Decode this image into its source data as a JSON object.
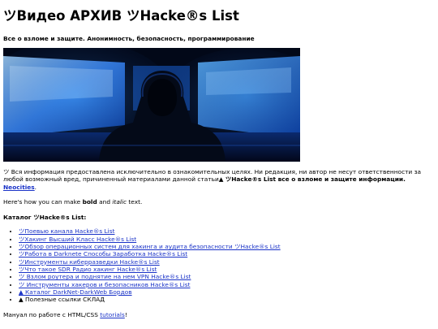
{
  "header": {
    "title": "ツВидео АРХИВ ツHacke®s List",
    "subtitle": "Все о взломе и защите. Анонимность, безопасность, программирование"
  },
  "hero": {
    "icon": "hacker-hoodie-monitors-image"
  },
  "info": {
    "text": "ツ Вся информация предоставлена исключительно в ознакомительных целях. Ни редакция, ни автор не несут ответственности за любой возможный вред, причиненный материалами данной статьи▲ ",
    "bold": "ツHacke®s List все о взломе и защите информации.",
    "link": "Neocities",
    "end": "."
  },
  "howto": {
    "prefix": "Here's how you can make ",
    "bold": "bold",
    "middle": " and ",
    "italic": "italic",
    "suffix": " text."
  },
  "catalog": {
    "title": "Каталог ツHacke®s List:",
    "items": [
      {
        "label": "ツПоевью канала Hacke®s List",
        "link": true
      },
      {
        "label": "ツХакинг Высший Класс Hacke®s List",
        "link": true
      },
      {
        "label": "ツОбзор операционных систем для хакинга и аудита безопасности ツHacke®s List",
        "link": true
      },
      {
        "label": "ツРабота в Darknete Способы Заработка Hacke®s List",
        "link": true
      },
      {
        "label": "ツИнструменты киберразведки Hacke®s List",
        "link": true
      },
      {
        "label": "ツЧто такое SDR Радио хакинг Hacke®s List",
        "link": true
      },
      {
        "label": "ツ Взлом роутера и поднятие на нем VPN Hacke®s List",
        "link": true
      },
      {
        "label": "ツ Инструменты хакеров и безопасников Hacke®s List",
        "link": true
      },
      {
        "label": "▲ Каталог DarkNet-DarkWeb Бордов",
        "link": true
      },
      {
        "label": "▲ Полезные ссылки СКЛАД",
        "link": false
      }
    ]
  },
  "manual": {
    "prefix": "Мануал по работе с HTML/CSS ",
    "link": "tutorials",
    "suffix": "!"
  }
}
